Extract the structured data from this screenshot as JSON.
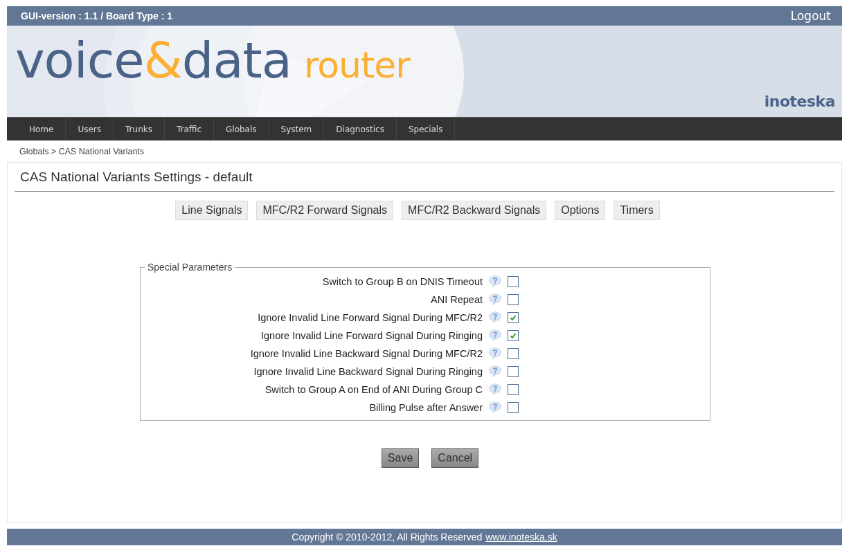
{
  "top_bar": {
    "version": "GUI-version : 1.1 / Board Type : 1",
    "logout": "Logout"
  },
  "banner": {
    "logo": [
      {
        "text": "voice",
        "kind": "primary"
      },
      {
        "text": "&",
        "kind": "accent"
      },
      {
        "text": "data",
        "kind": "primary"
      },
      {
        "text": "router",
        "kind": "accent"
      }
    ],
    "brand": "inoteska"
  },
  "nav": [
    "Home",
    "Users",
    "Trunks",
    "Traffic",
    "Globals",
    "System",
    "Diagnostics",
    "Specials"
  ],
  "breadcrumb": "Globals > CAS National Variants",
  "page_title": "CAS National Variants Settings - default",
  "tabs": [
    "Line Signals",
    "MFC/R2 Forward Signals",
    "MFC/R2 Backward Signals",
    "Options",
    "Timers"
  ],
  "fieldset": {
    "legend": "Special Parameters",
    "rows": [
      {
        "label": "Switch to Group B on DNIS Timeout",
        "checked": false
      },
      {
        "label": "ANI Repeat",
        "checked": false
      },
      {
        "label": "Ignore Invalid Line Forward Signal During MFC/R2",
        "checked": true
      },
      {
        "label": "Ignore Invalid Line Forward Signal During Ringing",
        "checked": true
      },
      {
        "label": "Ignore Invalid Line Backward Signal During MFC/R2",
        "checked": false
      },
      {
        "label": "Ignore Invalid Line Backward Signal During Ringing",
        "checked": false
      },
      {
        "label": "Switch to Group A on End of ANI During Group C",
        "checked": false
      },
      {
        "label": "Billing Pulse after Answer",
        "checked": false
      }
    ]
  },
  "buttons": [
    "Save",
    "Cancel"
  ],
  "footer": {
    "text": "Copyright © 2010-2012, All Rights Reserved",
    "link": "www.inoteska.sk"
  }
}
